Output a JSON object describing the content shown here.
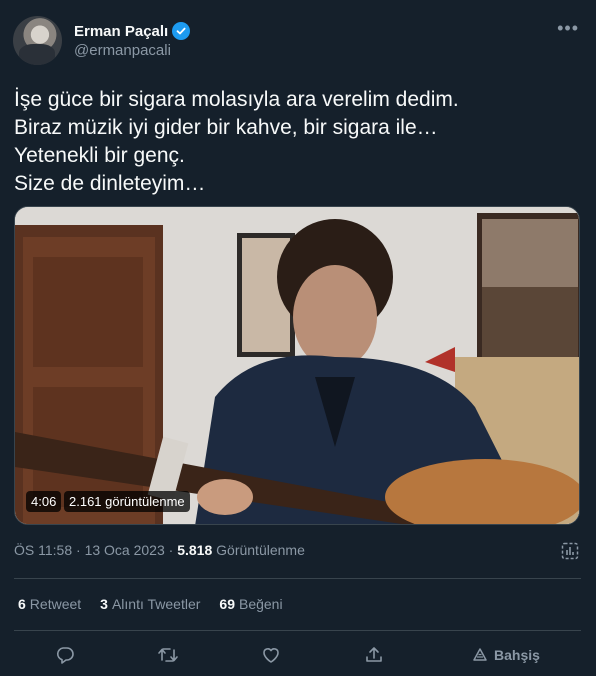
{
  "author": {
    "name": "Erman Paçalı",
    "handle": "@ermanpacali",
    "more_icon": "more-horizontal-icon",
    "verified_icon": "verified-badge-icon"
  },
  "tweet": {
    "lines": [
      "İşe güce bir sigara molasıyla ara verelim dedim.",
      "Biraz müzik iyi gider bir kahve, bir sigara ile…",
      "Yetenekli bir genç.",
      "Size de dinleteyim…"
    ]
  },
  "video": {
    "duration": "4:06",
    "views": "2.161 görüntülenme"
  },
  "meta": {
    "time": "ÖS 11:58",
    "separator1": " · ",
    "date": "13 Oca 2023",
    "separator2": " · ",
    "views_count": "5.818",
    "views_label": "Görüntülenme"
  },
  "stats": {
    "retweets_count": "6",
    "retweets_label": "Retweet",
    "quotes_count": "3",
    "quotes_label": "Alıntı Tweetler",
    "likes_count": "69",
    "likes_label": "Beğeni"
  },
  "actions": {
    "reply_icon": "reply-icon",
    "retweet_icon": "retweet-icon",
    "like_icon": "heart-icon",
    "share_icon": "share-icon",
    "tip_label": "Bahşiş"
  },
  "colors": {
    "background": "#15202b",
    "text": "#f7f9f9",
    "secondary": "#8b98a5",
    "border": "#38444d",
    "accent": "#1d9bf0"
  }
}
